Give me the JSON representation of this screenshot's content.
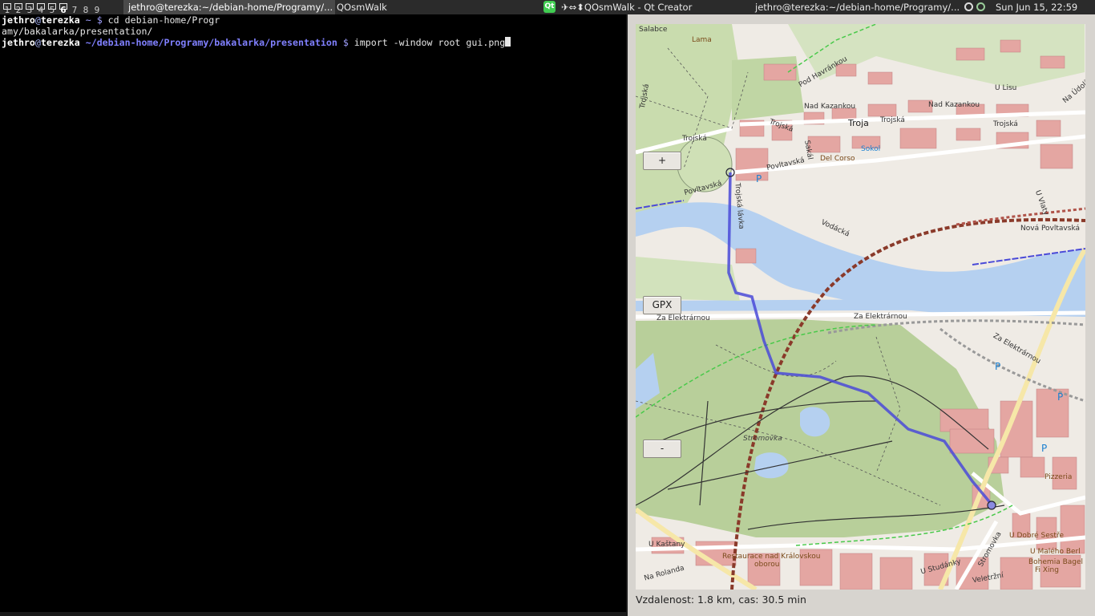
{
  "panel": {
    "workspaces": [
      "1",
      "2",
      "3",
      "4",
      "5",
      "6",
      "7",
      "8",
      "9"
    ],
    "current_workspace": "6",
    "tasks": [
      {
        "label": "jethro@terezka:~/debian-home/Programy/...",
        "active": true
      },
      {
        "label": "QOsmWalk",
        "active": false
      },
      {
        "label": "✈⇔⬍QOsmWalk - Qt Creator",
        "active": false
      },
      {
        "label": "jethro@terezka:~/debian-home/Programy/...",
        "active": false
      }
    ],
    "qt_icon_text": "Qt",
    "clock": "Sun Jun 15, 22:59"
  },
  "terminal": {
    "user": "jethro",
    "host": "terezka",
    "line1": {
      "path": "~",
      "prompt": "$",
      "command": "cd debian-home/Progr"
    },
    "line2": "amy/bakalarka/presentation/",
    "line3": {
      "path": "~/debian-home/Programy/bakalarka/presentation",
      "prompt": "$",
      "command": "import -window root gui.png"
    }
  },
  "map": {
    "zoom_in_label": "+",
    "zoom_out_label": "-",
    "gpx_label": "GPX",
    "labels": {
      "salabce": "Salabce",
      "lama": "Lama",
      "pod_havrankou": "Pod Havránkou",
      "u_lisu": "U Lisu",
      "na_udoli": "Na Údolí",
      "nad_kazankou_1": "Nad Kazankou",
      "nad_kazankou_2": "Nad Kazankou",
      "trojska_1": "Trojská",
      "trojska_2": "Trojská",
      "trojska_3": "Trojská",
      "trojska_4": "Trojská",
      "trojska_5": "Trojská",
      "troja": "Troja",
      "sokol": "Sokol",
      "sakal": "Sakál",
      "del_corso": "Del Corso",
      "povltavska_1": "Povltavská",
      "povltavska_2": "Povltavská",
      "trojska_lavka": "Trojská lávka",
      "u_vlachovky": "U Vlaty",
      "vodacka": "Vodácká",
      "nova_povltavska": "Nová Povltavská",
      "za_elektrarnou_1": "Za Elektrárnou",
      "za_elektrarnou_2": "Za Elektrárnou",
      "za_elektrarnou_3": "Za Elektrárnou",
      "stromovka": "Stromovka",
      "pizzeria": "Pizzeria",
      "u_kastany": "U Kaštany",
      "restaurace": "Restaurace nad Královskou",
      "restaurace_2": "oborou",
      "u_dobre_sestre": "U Dobré Sestře",
      "u_maleho_berl": "U Malého Berl",
      "bohemia_bagel": "Bohemia Bagel",
      "fi_xing": "Fi Xing",
      "u_studanky": "U Studánky",
      "stromovka_st": "Stromovka",
      "veletrzni": "Veletržní",
      "na_rollanda": "Na Rolanda",
      "p": "P"
    }
  },
  "status": "Vzdalenost: 1.8 km, cas: 30.5 min",
  "colors": {
    "route": "#4a4ad8",
    "water": "#b5d0f0",
    "park": "#b8cf9a",
    "railway": "#8a3a2a",
    "building": "#e4a6a2"
  }
}
